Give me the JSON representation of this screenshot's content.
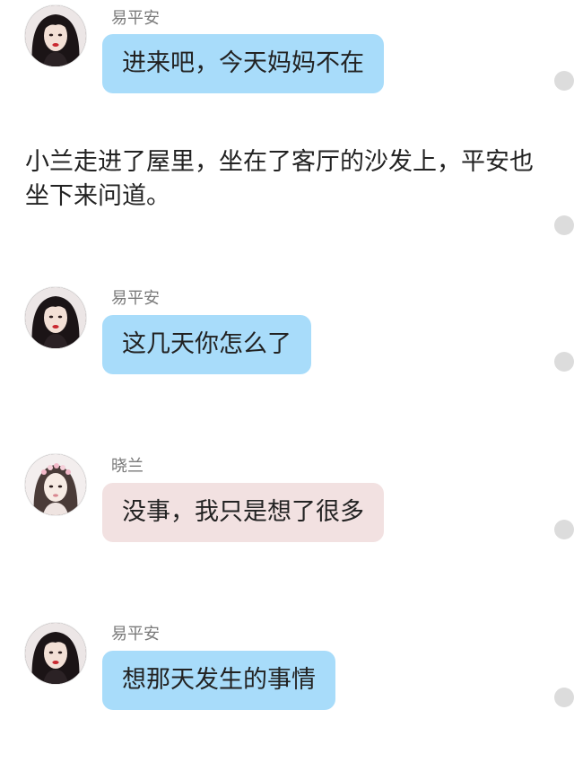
{
  "messages": [
    {
      "sender": "易平安",
      "text": "进来吧，今天妈妈不在",
      "bubble_color": "#a8dcfa"
    },
    {
      "sender": "易平安",
      "text": "这几天你怎么了",
      "bubble_color": "#a8dcfa"
    },
    {
      "sender": "晓兰",
      "text": "没事，我只是想了很多",
      "bubble_color": "#f2e1e1"
    },
    {
      "sender": "易平安",
      "text": "想那天发生的事情",
      "bubble_color": "#a8dcfa"
    }
  ],
  "narration": {
    "line1": "小兰走进了屋里，坐在了客厅的沙发上，平安也",
    "line2": "坐下来问道。"
  },
  "colors": {
    "self_bubble": "#a8dcfa",
    "other_bubble": "#f2e1e1",
    "name_text": "#7a7a7a",
    "side_dot": "#dcdcdc"
  },
  "icons": {
    "avatar_pingan": "avatar-dark-hair-portrait",
    "avatar_xiaolan": "avatar-flower-crown-portrait",
    "side_marker": "scroll-dot-marker"
  }
}
